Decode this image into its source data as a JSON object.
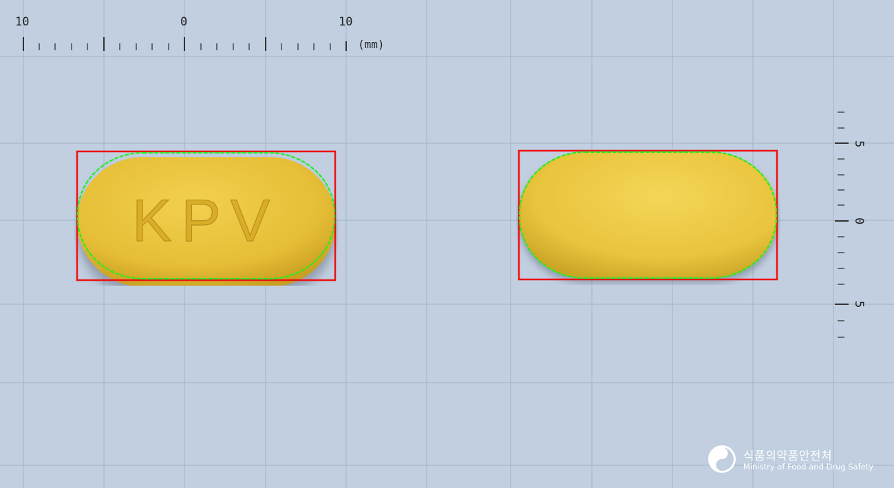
{
  "ruler_top": {
    "labels": [
      "10",
      "0",
      "10"
    ],
    "unit": "(mm)"
  },
  "ruler_right": {
    "labels": [
      "5",
      "0",
      "5"
    ]
  },
  "pill_front": {
    "imprint": "KPV",
    "color": "#e9c53e"
  },
  "pill_back": {
    "imprint": "",
    "color": "#eccb48"
  },
  "logo": {
    "korean": "식품의약품안전처",
    "english": "Ministry of Food and Drug Safety"
  },
  "colors": {
    "background": "#c1cfe1",
    "grid": "#a9b9cc",
    "bbox": "#ee1111",
    "contour": "#22ee22"
  }
}
